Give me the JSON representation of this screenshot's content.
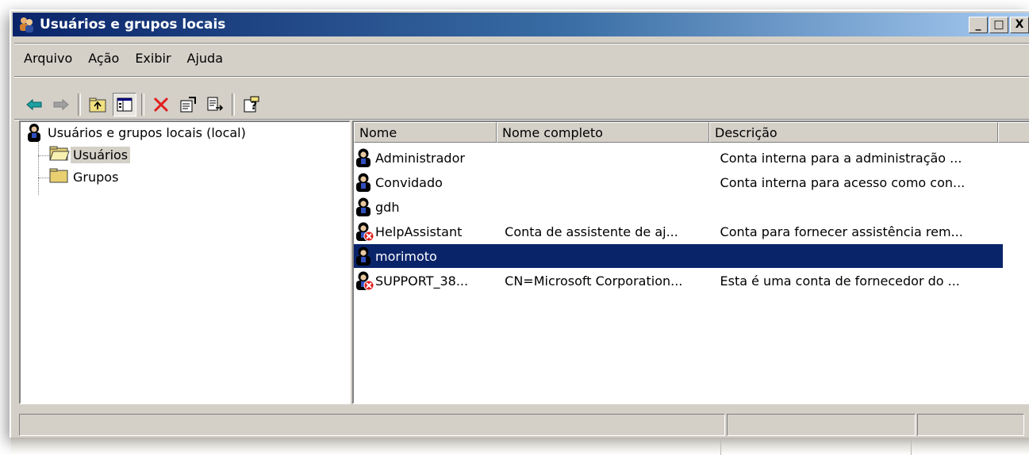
{
  "window": {
    "title": "Usuários e grupos locais",
    "controls": {
      "minimize": "_",
      "maximize": "□",
      "close": "X"
    }
  },
  "menu": [
    "Arquivo",
    "Ação",
    "Exibir",
    "Ajuda"
  ],
  "toolbar": {
    "icons": [
      "back-arrow-icon",
      "forward-arrow-icon",
      "up-folder-icon",
      "show-hide-tree-icon",
      "delete-icon",
      "properties-icon",
      "export-list-icon",
      "help-icon"
    ],
    "colors": {
      "back_arrow": "#008080",
      "delete": "#e02020"
    }
  },
  "tree": {
    "root": "Usuários e grupos locais (local)",
    "children": [
      {
        "label": "Usuários",
        "selected": true
      },
      {
        "label": "Grupos",
        "selected": false
      }
    ]
  },
  "list": {
    "columns": [
      "Nome",
      "Nome completo",
      "Descrição",
      ""
    ],
    "rows": [
      {
        "name": "Administrador",
        "full_name": "",
        "description": "Conta interna para a administração ...",
        "disabled": false,
        "selected": false
      },
      {
        "name": "Convidado",
        "full_name": "",
        "description": "Conta interna para acesso como con...",
        "disabled": false,
        "selected": false
      },
      {
        "name": "gdh",
        "full_name": "",
        "description": "",
        "disabled": false,
        "selected": false
      },
      {
        "name": "HelpAssistant",
        "full_name": "Conta de assistente de aj...",
        "description": "Conta para fornecer assistência rem...",
        "disabled": true,
        "selected": false
      },
      {
        "name": "morimoto",
        "full_name": "",
        "description": "",
        "disabled": false,
        "selected": true
      },
      {
        "name": "SUPPORT_38...",
        "full_name": "CN=Microsoft Corporation...",
        "description": "Esta é uma conta de fornecedor do ...",
        "disabled": true,
        "selected": false
      }
    ]
  },
  "colors": {
    "title_start": "#0a246a",
    "title_end": "#a6caf0",
    "selection": "#0a246a",
    "face": "#d4d0c8"
  }
}
